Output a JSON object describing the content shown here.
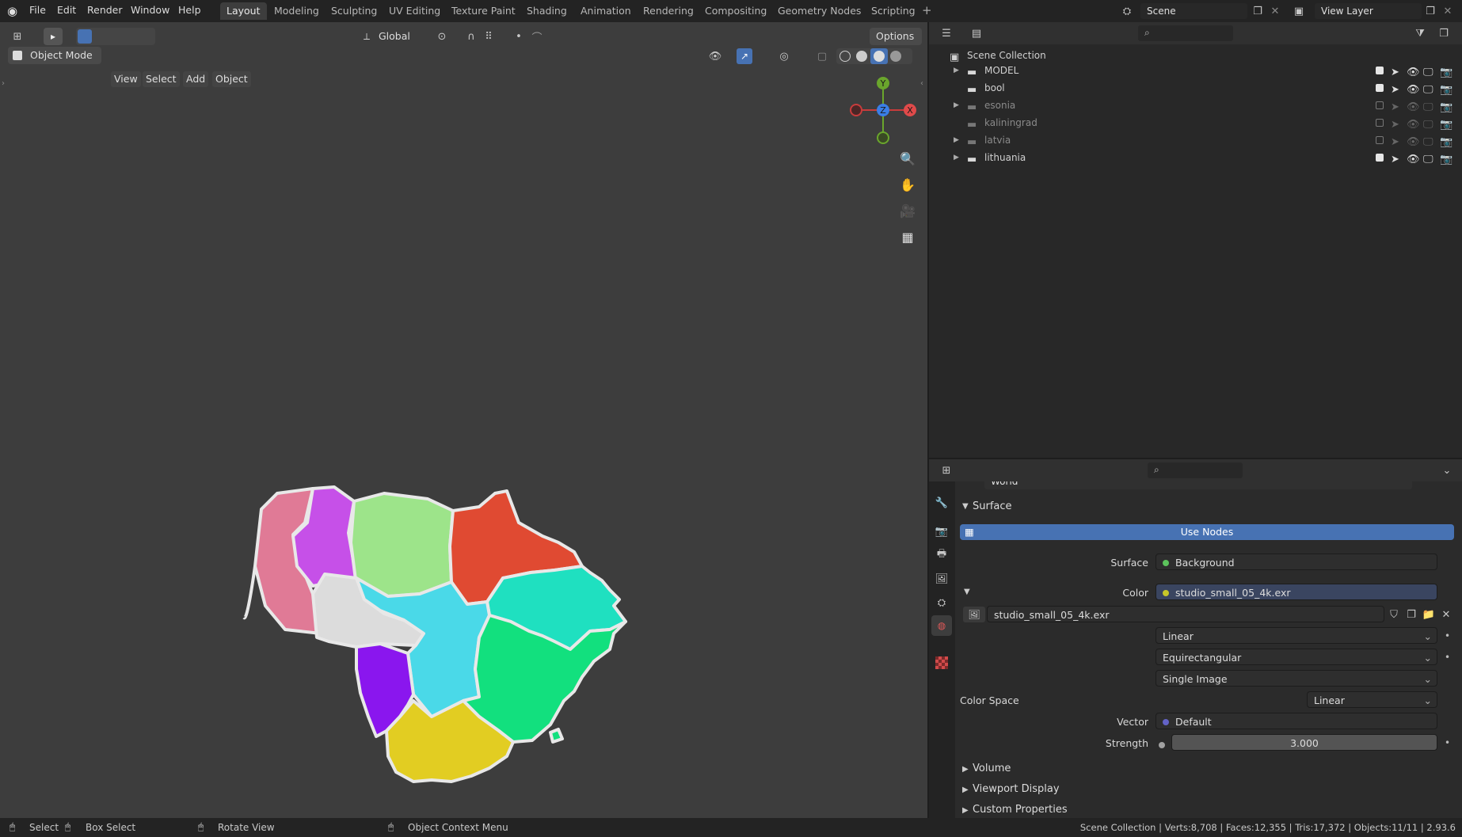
{
  "menu": [
    "File",
    "Edit",
    "Render",
    "Window",
    "Help"
  ],
  "workspaces": [
    "Layout",
    "Modeling",
    "Sculpting",
    "UV Editing",
    "Texture Paint",
    "Shading",
    "Animation",
    "Rendering",
    "Compositing",
    "Geometry Nodes",
    "Scripting"
  ],
  "scene": {
    "name": "Scene",
    "view_layer": "View Layer"
  },
  "viewport": {
    "mode": "Object Mode",
    "menus": [
      "View",
      "Select",
      "Add",
      "Object"
    ],
    "orientation": "Global",
    "options": "Options",
    "gizmo": {
      "x": "X",
      "y": "Y",
      "z": "Z"
    }
  },
  "outliner": {
    "root": "Scene Collection",
    "items": [
      {
        "name": "MODEL",
        "checked": true,
        "disabled": false
      },
      {
        "name": "bool",
        "checked": true,
        "disabled": false
      },
      {
        "name": "esonia",
        "checked": false,
        "disabled": true
      },
      {
        "name": "kaliningrad",
        "checked": false,
        "disabled": true
      },
      {
        "name": "latvia",
        "checked": false,
        "disabled": true
      },
      {
        "name": "lithuania",
        "checked": true,
        "disabled": false
      }
    ]
  },
  "properties": {
    "world_name": "World",
    "surface_section": "Surface",
    "use_nodes": "Use Nodes",
    "surface_label": "Surface",
    "surface_value": "Background",
    "color_label": "Color",
    "color_value": "studio_small_05_4k.exr",
    "image_name": "studio_small_05_4k.exr",
    "interpolation": "Linear",
    "projection": "Equirectangular",
    "source": "Single Image",
    "color_space_label": "Color Space",
    "color_space": "Linear",
    "vector_label": "Vector",
    "vector_value": "Default",
    "strength_label": "Strength",
    "strength_value": "3.000",
    "sections": [
      "Volume",
      "Viewport Display",
      "Custom Properties"
    ]
  },
  "status": {
    "select": "Select",
    "box_select": "Box Select",
    "rotate_view": "Rotate View",
    "context_menu": "Object Context Menu",
    "stats": "Scene Collection | Verts:8,708 | Faces:12,355 | Tris:17,372 | Objects:11/11 | 2.93.6"
  },
  "colors": {
    "accent": "#4772b3",
    "region_pink": "#e07a96",
    "region_magenta": "#c650e8",
    "region_lightgreen": "#9de48a",
    "region_red": "#e04a32",
    "region_aqua": "#1fe0c0",
    "region_white": "#dcdcdc",
    "region_cyan": "#4ad9e8",
    "region_green": "#12e07e",
    "region_purple": "#8a16ee",
    "region_yellow": "#e2cd22"
  }
}
